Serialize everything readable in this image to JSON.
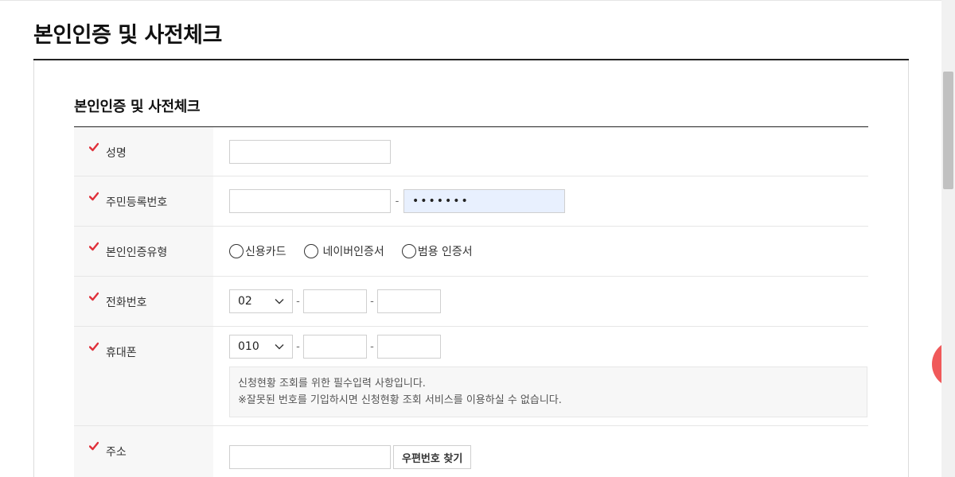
{
  "page": {
    "title": "본인인증 및 사전체크"
  },
  "section": {
    "title": "본인인증 및 사전체크"
  },
  "colors": {
    "required_mark": "#e0303a",
    "autofill": "#e8f0fe",
    "floating_button": "#f0595a"
  },
  "icons": {
    "required": "checkmark-icon",
    "select_arrow": "chevron-down-icon"
  },
  "form": {
    "name": {
      "label": "성명",
      "value": ""
    },
    "rrn": {
      "label": "주민등록번호",
      "front_value": "",
      "separator": "-",
      "back_value": "•••••••"
    },
    "auth_type": {
      "label": "본인인증유형",
      "options": [
        {
          "label": "신용카드"
        },
        {
          "label": "네이버인증서"
        },
        {
          "label": "범용 인증서"
        }
      ]
    },
    "phone": {
      "label": "전화번호",
      "area_code": "02",
      "separator": "-",
      "middle": "",
      "last": ""
    },
    "mobile": {
      "label": "휴대폰",
      "prefix": "010",
      "separator": "-",
      "middle": "",
      "last": "",
      "notice_line1": "신청현황 조회를 위한 필수입력 사항입니다.",
      "notice_line2": "※잘못된 번호를 기입하시면 신청현황 조회 서비스를 이용하실 수 없습니다."
    },
    "address": {
      "label": "주소",
      "value": "",
      "search_button": "우편번호 찾기"
    }
  }
}
